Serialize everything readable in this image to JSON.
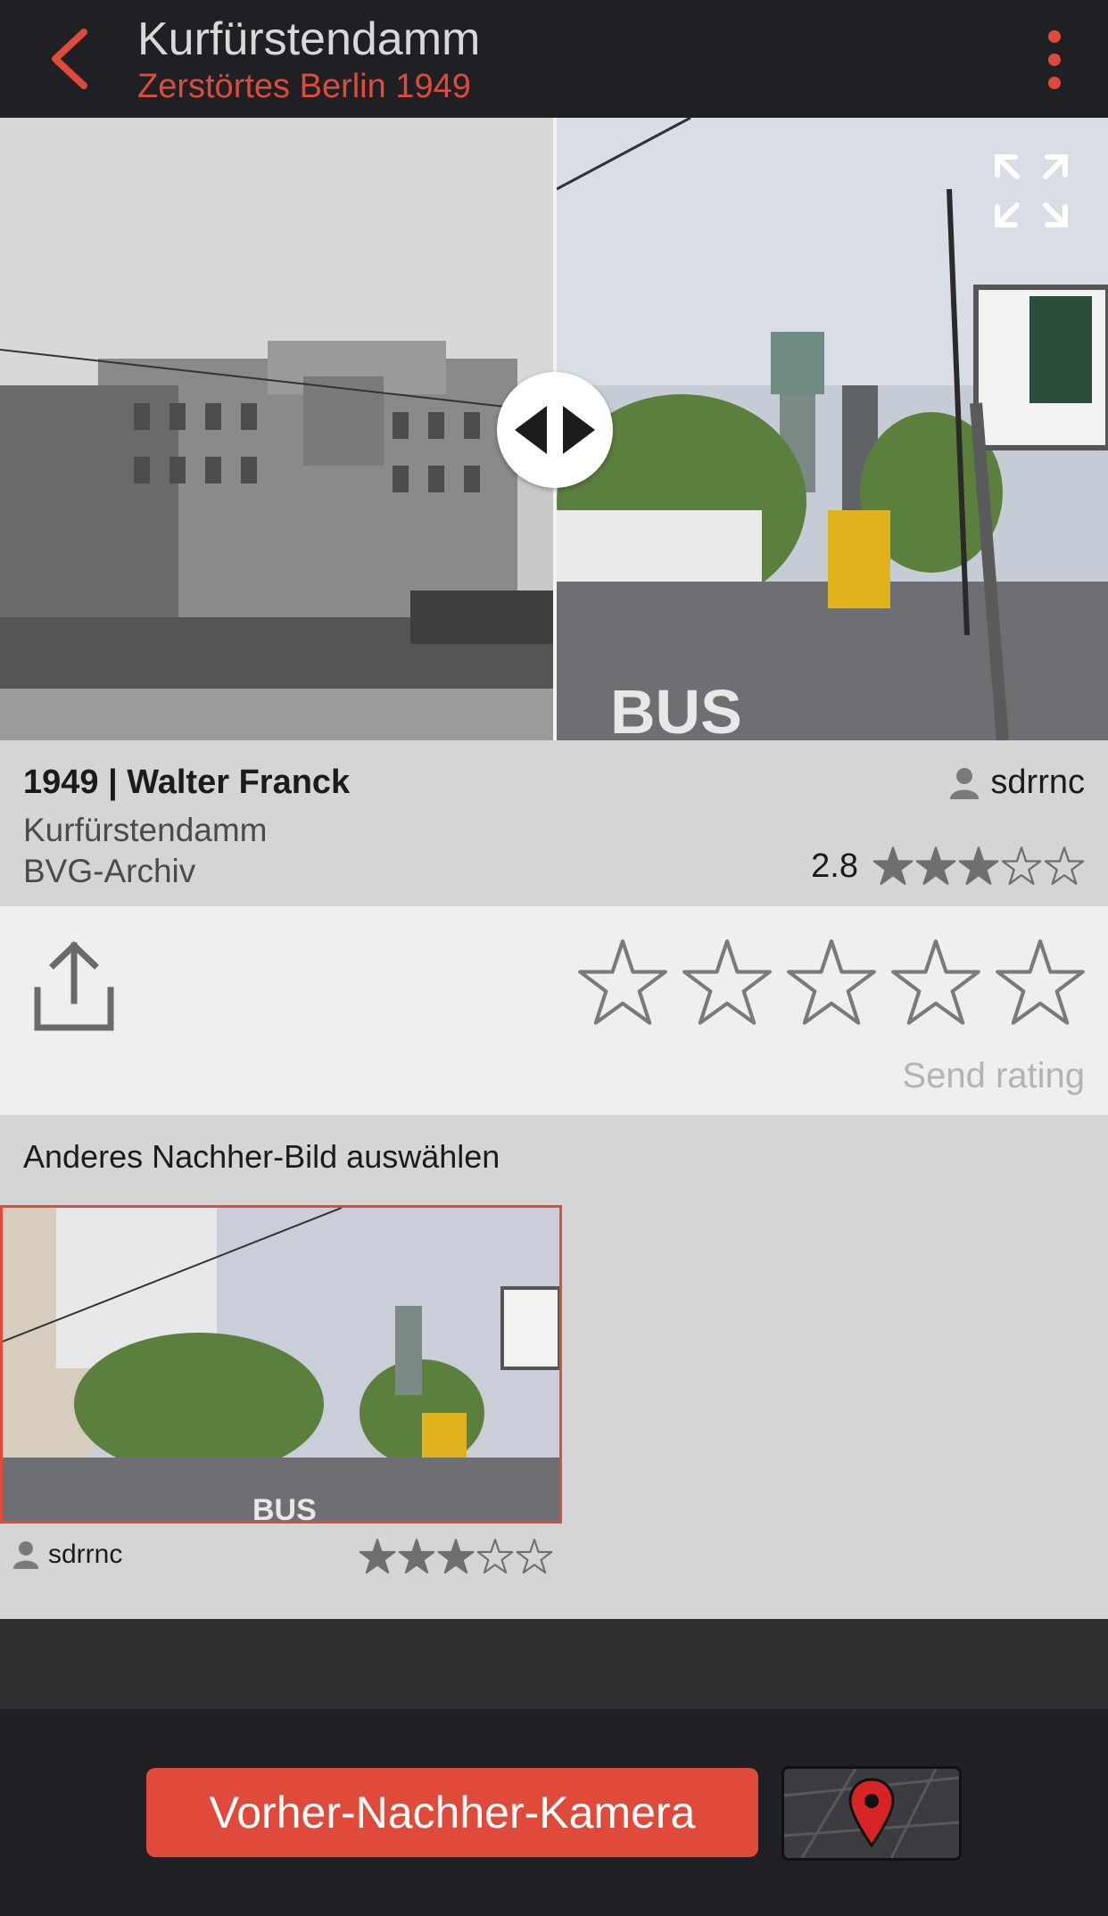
{
  "header": {
    "title": "Kurfürstendamm",
    "subtitle": "Zerstörtes Berlin 1949",
    "back_icon": "chevron-left-icon",
    "more_icon": "more-vertical-icon"
  },
  "colors": {
    "accent": "#e04a3a",
    "header_bg": "#1f2024",
    "panel_bg": "#d5d5d5",
    "rating_panel_bg": "#efefef",
    "star_filled": "#6e6e6e"
  },
  "comparison": {
    "before_photo": "black-and-white Kurfürstendamm 1949",
    "after_photo": "present-day Kurfürstendamm",
    "slider_icon": "split-arrows-icon",
    "expand_icon": "fullscreen-icon"
  },
  "info": {
    "year_author": "1949 | Walter Franck",
    "location": "Kurfürstendamm",
    "source": "BVG-Archiv",
    "user": "sdrrnc",
    "rating_value": "2.8",
    "rating_filled": 3,
    "rating_max": 5
  },
  "rate": {
    "share_icon": "share-icon",
    "send_label": "Send rating",
    "stars": 5
  },
  "alternatives": {
    "title": "Anderes Nachher-Bild auswählen",
    "items": [
      {
        "user": "sdrrnc",
        "rating_filled": 3,
        "rating_max": 5
      }
    ]
  },
  "bottom": {
    "camera_button": "Vorher-Nachher-Kamera",
    "map_icon": "map-pin-icon"
  }
}
